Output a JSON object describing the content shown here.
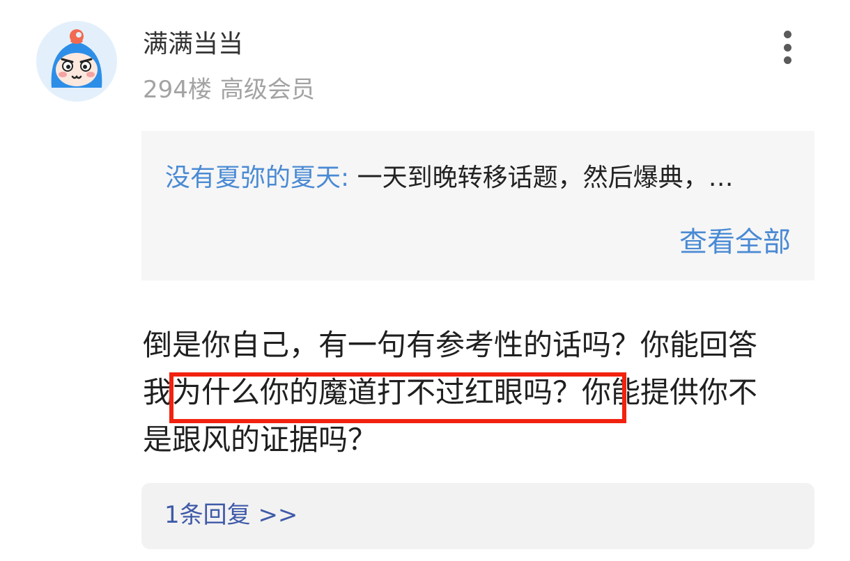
{
  "post": {
    "username": "满满当当",
    "floor": "294楼",
    "member_level": "高级会员",
    "avatar_icon": "cartoon-avatar-icon",
    "more_icon": "more-vertical-icon"
  },
  "quote": {
    "author": "没有夏弥的夏天:",
    "text": "一天到晚转移话题，然后爆典，…",
    "view_all_label": "查看全部"
  },
  "comment": {
    "lines": [
      "倒是你自己，有一句有参考性的话吗？你能回答",
      "我为什么你的魔道打不过红眼吗？你能提供你不",
      "是跟风的证据吗？"
    ],
    "highlighted_text": "为什么你的魔道打不过红眼吗？"
  },
  "replies": {
    "label": "1条回复 >>"
  },
  "colors": {
    "link_blue": "#4a8ad4",
    "reply_blue": "#3f5aa8",
    "highlight_red": "#f1220f",
    "quote_bg": "#f6f6f6",
    "reply_bg": "#f2f2f2",
    "meta_gray": "#a3a3a3"
  }
}
